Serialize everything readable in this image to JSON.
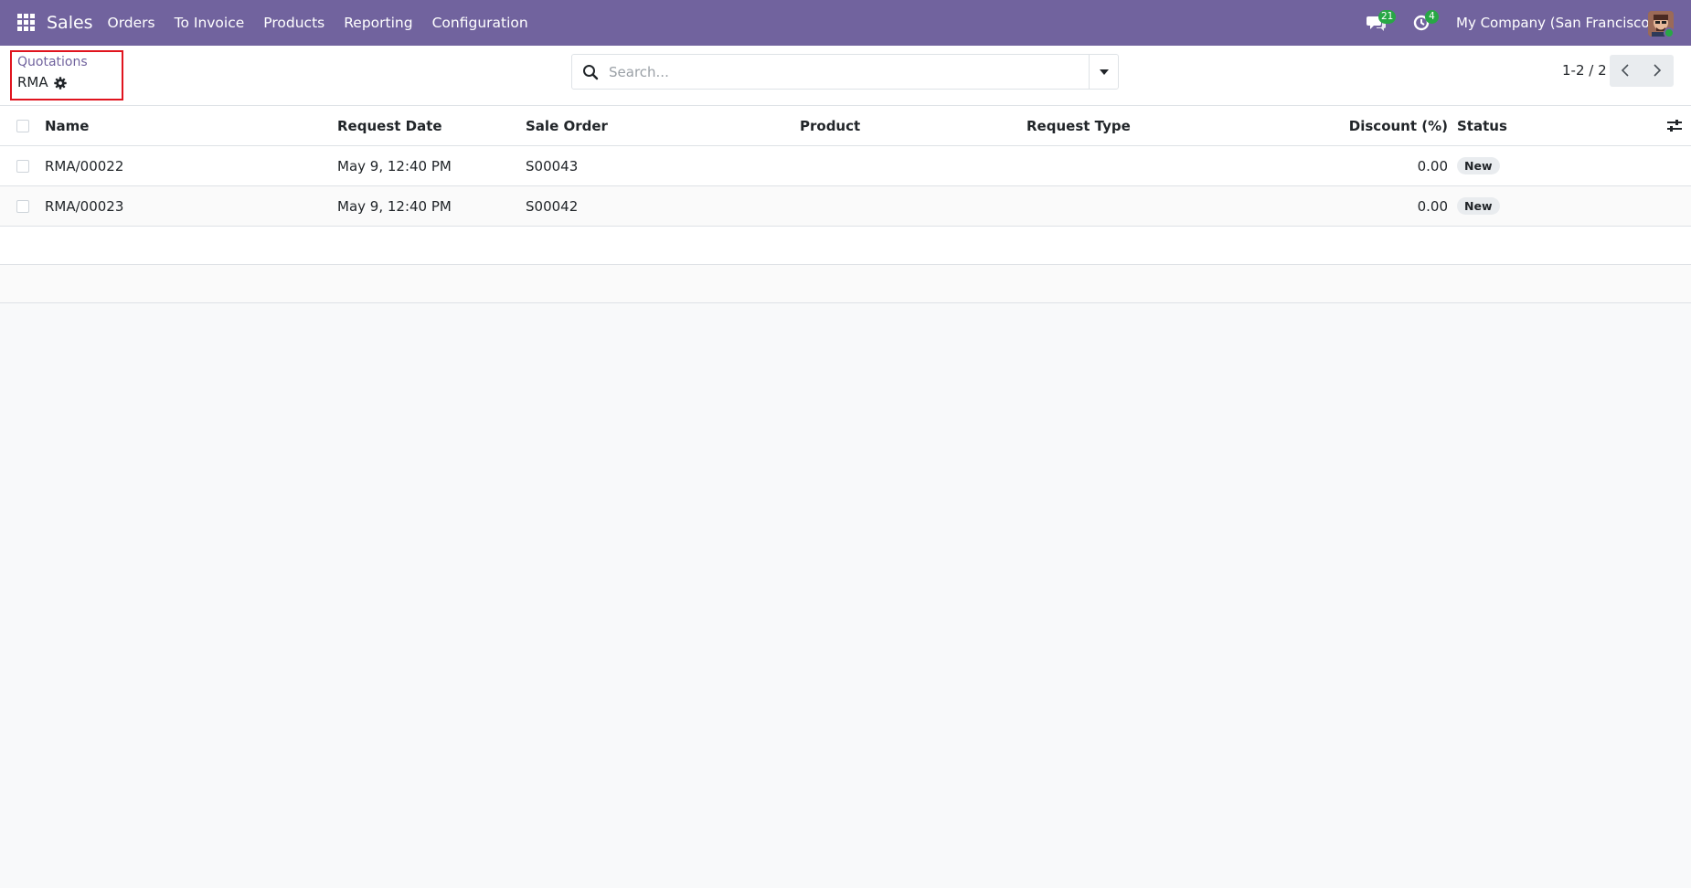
{
  "navbar": {
    "app_name": "Sales",
    "menu": [
      "Orders",
      "To Invoice",
      "Products",
      "Reporting",
      "Configuration"
    ],
    "messages_count": "21",
    "activities_count": "4",
    "company": "My Company (San Francisco)"
  },
  "breadcrumb": {
    "parent": "Quotations",
    "current": "RMA"
  },
  "search": {
    "placeholder": "Search..."
  },
  "pager": {
    "value": "1-2 / 2"
  },
  "table": {
    "columns": {
      "name": "Name",
      "request_date": "Request Date",
      "sale_order": "Sale Order",
      "product": "Product",
      "request_type": "Request Type",
      "discount": "Discount (%)",
      "status": "Status"
    },
    "rows": [
      {
        "name": "RMA/00022",
        "request_date": "May 9, 12:40 PM",
        "sale_order": "S00043",
        "product": "",
        "request_type": "",
        "discount": "0.00",
        "status": "New"
      },
      {
        "name": "RMA/00023",
        "request_date": "May 9, 12:40 PM",
        "sale_order": "S00042",
        "product": "",
        "request_type": "",
        "discount": "0.00",
        "status": "New"
      }
    ]
  },
  "colors": {
    "navbar": "#71639e",
    "badge": "#28a745",
    "highlight": "#e0141e"
  }
}
